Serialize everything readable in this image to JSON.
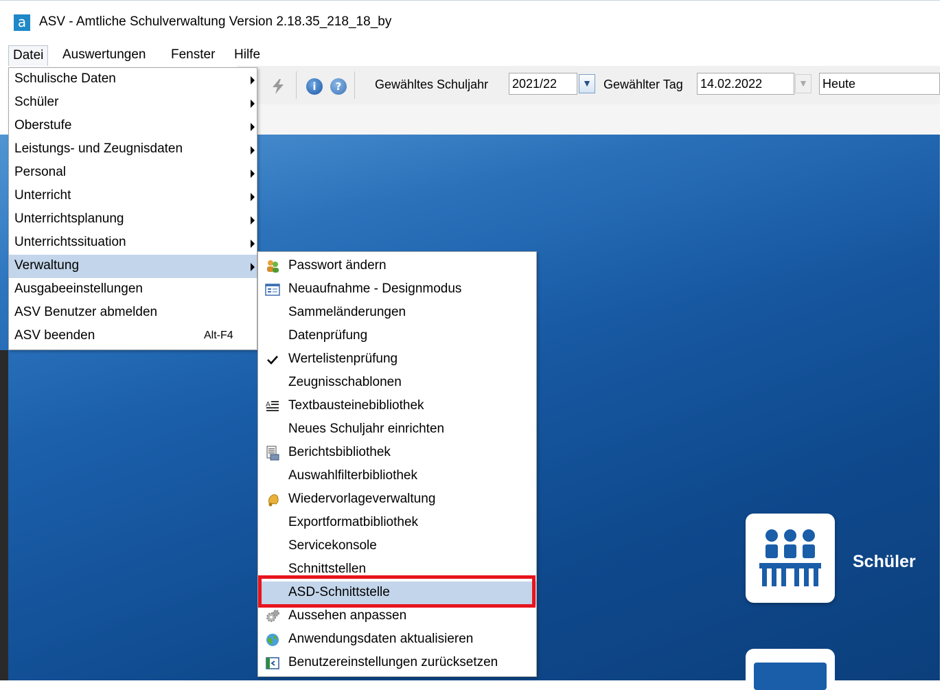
{
  "window": {
    "logo": "a",
    "title": "ASV - Amtliche Schulverwaltung Version 2.18.35_218_18_by"
  },
  "menubar": {
    "items": [
      "Datei",
      "Auswertungen",
      "Fenster",
      "Hilfe"
    ]
  },
  "toolbar": {
    "schuljahr_label": "Gewähltes Schuljahr",
    "schuljahr_value": "2021/22",
    "tag_label": "Gewählter Tag",
    "tag_value": "14.02.2022",
    "heute_value": "Heute",
    "icons": [
      "lightning-icon",
      "info-icon",
      "help-icon"
    ]
  },
  "datei_menu": {
    "items": [
      {
        "label": "Schulische Daten",
        "submenu": true
      },
      {
        "label": "Schüler",
        "submenu": true
      },
      {
        "label": "Oberstufe",
        "submenu": true
      },
      {
        "label": "Leistungs- und Zeugnisdaten",
        "submenu": true
      },
      {
        "label": "Personal",
        "submenu": true
      },
      {
        "label": "Unterricht",
        "submenu": true
      },
      {
        "label": "Unterrichtsplanung",
        "submenu": true
      },
      {
        "label": "Unterrichtssituation",
        "submenu": true
      },
      {
        "label": "Verwaltung",
        "submenu": true,
        "selected": true
      },
      {
        "label": "Ausgabeeinstellungen"
      },
      {
        "label": "ASV Benutzer abmelden"
      },
      {
        "label": "ASV beenden",
        "shortcut": "Alt-F4"
      }
    ]
  },
  "verwaltung_menu": {
    "items": [
      {
        "label": "Passwort ändern",
        "icon": "key-users-icon"
      },
      {
        "label": "Neuaufnahme - Designmodus",
        "icon": "form-icon"
      },
      {
        "label": "Sammeländerungen"
      },
      {
        "label": "Datenprüfung"
      },
      {
        "label": "Wertelistenprüfung",
        "icon": "checkmark-icon"
      },
      {
        "label": "Zeugnisschablonen"
      },
      {
        "label": "Textbausteinebibliothek",
        "icon": "text-block-icon"
      },
      {
        "label": "Neues Schuljahr einrichten"
      },
      {
        "label": "Berichtsbibliothek",
        "icon": "report-icon"
      },
      {
        "label": "Auswahlfilterbibliothek"
      },
      {
        "label": "Wiedervorlageverwaltung",
        "icon": "bell-icon"
      },
      {
        "label": "Exportformatbibliothek"
      },
      {
        "label": "Servicekonsole"
      },
      {
        "label": "Schnittstellen"
      },
      {
        "label": "ASD-Schnittstelle",
        "selected": true
      },
      {
        "label": "Aussehen anpassen",
        "icon": "gears-icon"
      },
      {
        "label": "Anwendungsdaten aktualisieren",
        "icon": "globe-refresh-icon"
      },
      {
        "label": "Benutzereinstellungen zurücksetzen",
        "icon": "reset-window-icon"
      }
    ]
  },
  "desktop": {
    "tile_label": "Schüler"
  },
  "colors": {
    "menu_selected": "#c3d5ea",
    "highlight": "#e8141e",
    "desktop_blue": "#1a5da8"
  }
}
